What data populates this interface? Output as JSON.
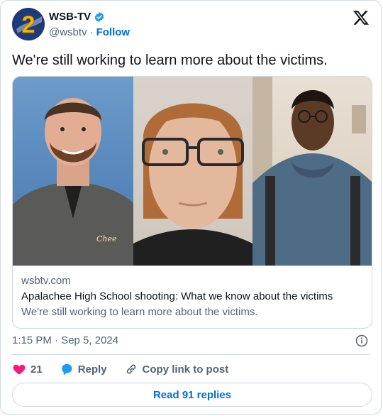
{
  "author": {
    "display_name": "WSB-TV",
    "handle": "@wsbtv",
    "separator": "·",
    "follow_label": "Follow",
    "avatar_icon": "channel-2-logo",
    "verified_icon": "verified-badge-icon"
  },
  "tweet": {
    "text": "We're still working to learn more about the victims."
  },
  "link_card": {
    "domain": "wsbtv.com",
    "title": "Apalachee High School shooting: What we know about the victims",
    "description": "We're still working to learn more about the victims."
  },
  "meta": {
    "timestamp": "1:15 PM · Sep 5, 2024"
  },
  "actions": {
    "like_count": "21",
    "reply_label": "Reply",
    "copy_label": "Copy link to post"
  },
  "footer": {
    "read_replies_label": "Read 91 replies"
  },
  "colors": {
    "accent": "#006fd6",
    "heart": "#f91880",
    "reply_bubble": "#1d9bf0",
    "muted_text": "#536471",
    "border": "#cfd9de"
  }
}
